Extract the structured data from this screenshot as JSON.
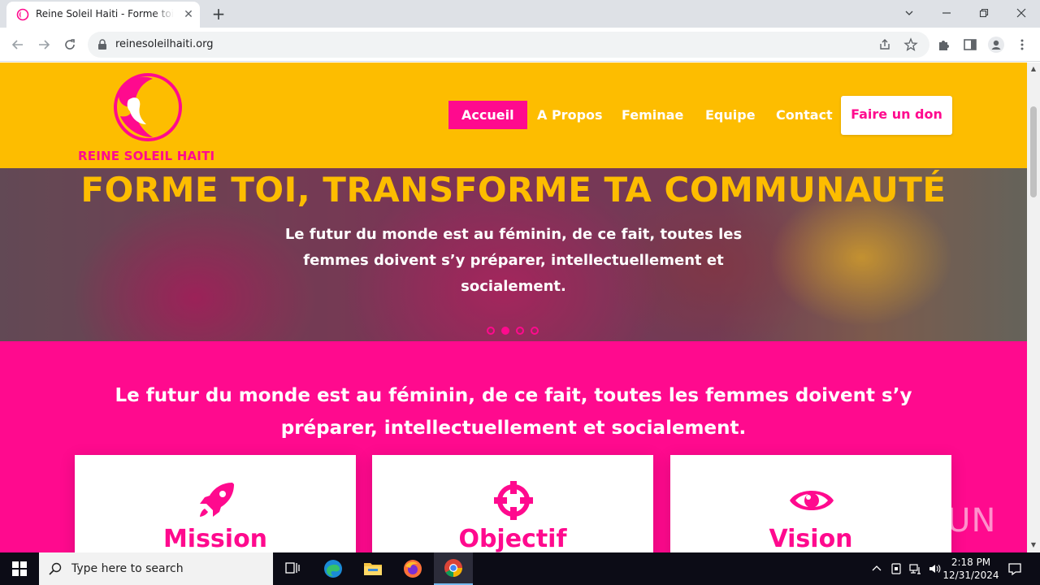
{
  "browser": {
    "tab_title": "Reine Soleil Haiti - Forme toi, transforme ta communauté",
    "url": "reinesoleilhaiti.org"
  },
  "site": {
    "logo_text": "REINE SOLEIL HAITI",
    "nav": [
      "Accueil",
      "A Propos",
      "Feminae",
      "Equipe",
      "Contact"
    ],
    "active_nav": "Accueil",
    "donate_label": "Faire un don",
    "accent": "#ff0a8e",
    "brand_yellow": "#fdbd00"
  },
  "hero": {
    "title": "FORME TOI, TRANSFORME TA COMMUNAUTÉ",
    "subtitle": "Le futur du monde est au féminin, de ce fait, toutes les femmes doivent s’y préparer, intellectuellement et socialement.",
    "slides_total": 4,
    "active_slide": 2
  },
  "intro": {
    "heading": "Le futur du monde est au féminin, de ce fait, toutes les femmes doivent s’y préparer, intellectuellement et socialement."
  },
  "cards": [
    {
      "title": "Mission",
      "icon": "rocket-icon"
    },
    {
      "title": "Objectif",
      "icon": "crosshair-icon"
    },
    {
      "title": "Vision",
      "icon": "eye-icon"
    }
  ],
  "watermark": "ANY RUN",
  "taskbar": {
    "search_placeholder": "Type here to search",
    "time": "2:18 PM",
    "date": "12/31/2024"
  }
}
